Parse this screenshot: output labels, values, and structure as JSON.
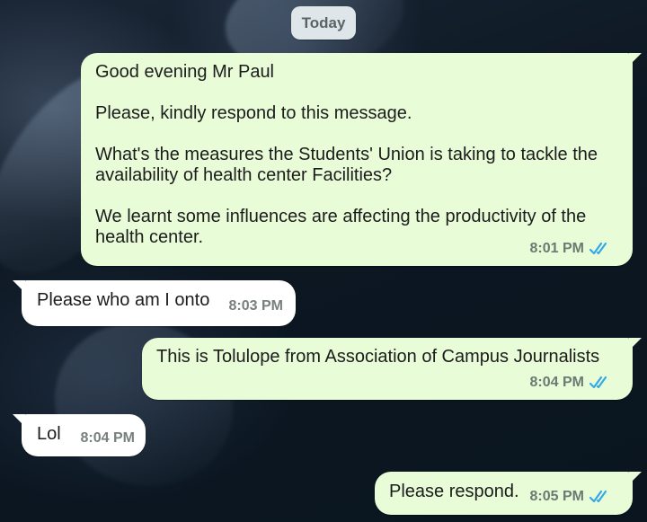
{
  "date_chip": "Today",
  "colors": {
    "outgoing_bubble": "#e8fcd8",
    "incoming_bubble": "#ffffff",
    "read_ticks": "#34a9e6"
  },
  "messages": [
    {
      "direction": "outgoing",
      "lines": [
        "Good evening Mr Paul",
        "",
        "Please, kindly respond to this message.",
        "",
        "What's the measures the Students' Union is taking to tackle the",
        "availability of health center Facilities?",
        "",
        "We learnt some influences are affecting the productivity of the",
        "health center."
      ],
      "time": "8:01 PM",
      "status_icon": "double-check-read-icon"
    },
    {
      "direction": "incoming",
      "text": "Please who am I onto",
      "time": "8:03 PM"
    },
    {
      "direction": "outgoing",
      "text": "This is Tolulope from Association of Campus Journalists",
      "time": "8:04 PM",
      "status_icon": "double-check-read-icon"
    },
    {
      "direction": "incoming",
      "text": "Lol",
      "time": "8:04 PM"
    },
    {
      "direction": "outgoing",
      "text": "Please respond.",
      "time": "8:05 PM",
      "status_icon": "double-check-read-icon"
    }
  ]
}
